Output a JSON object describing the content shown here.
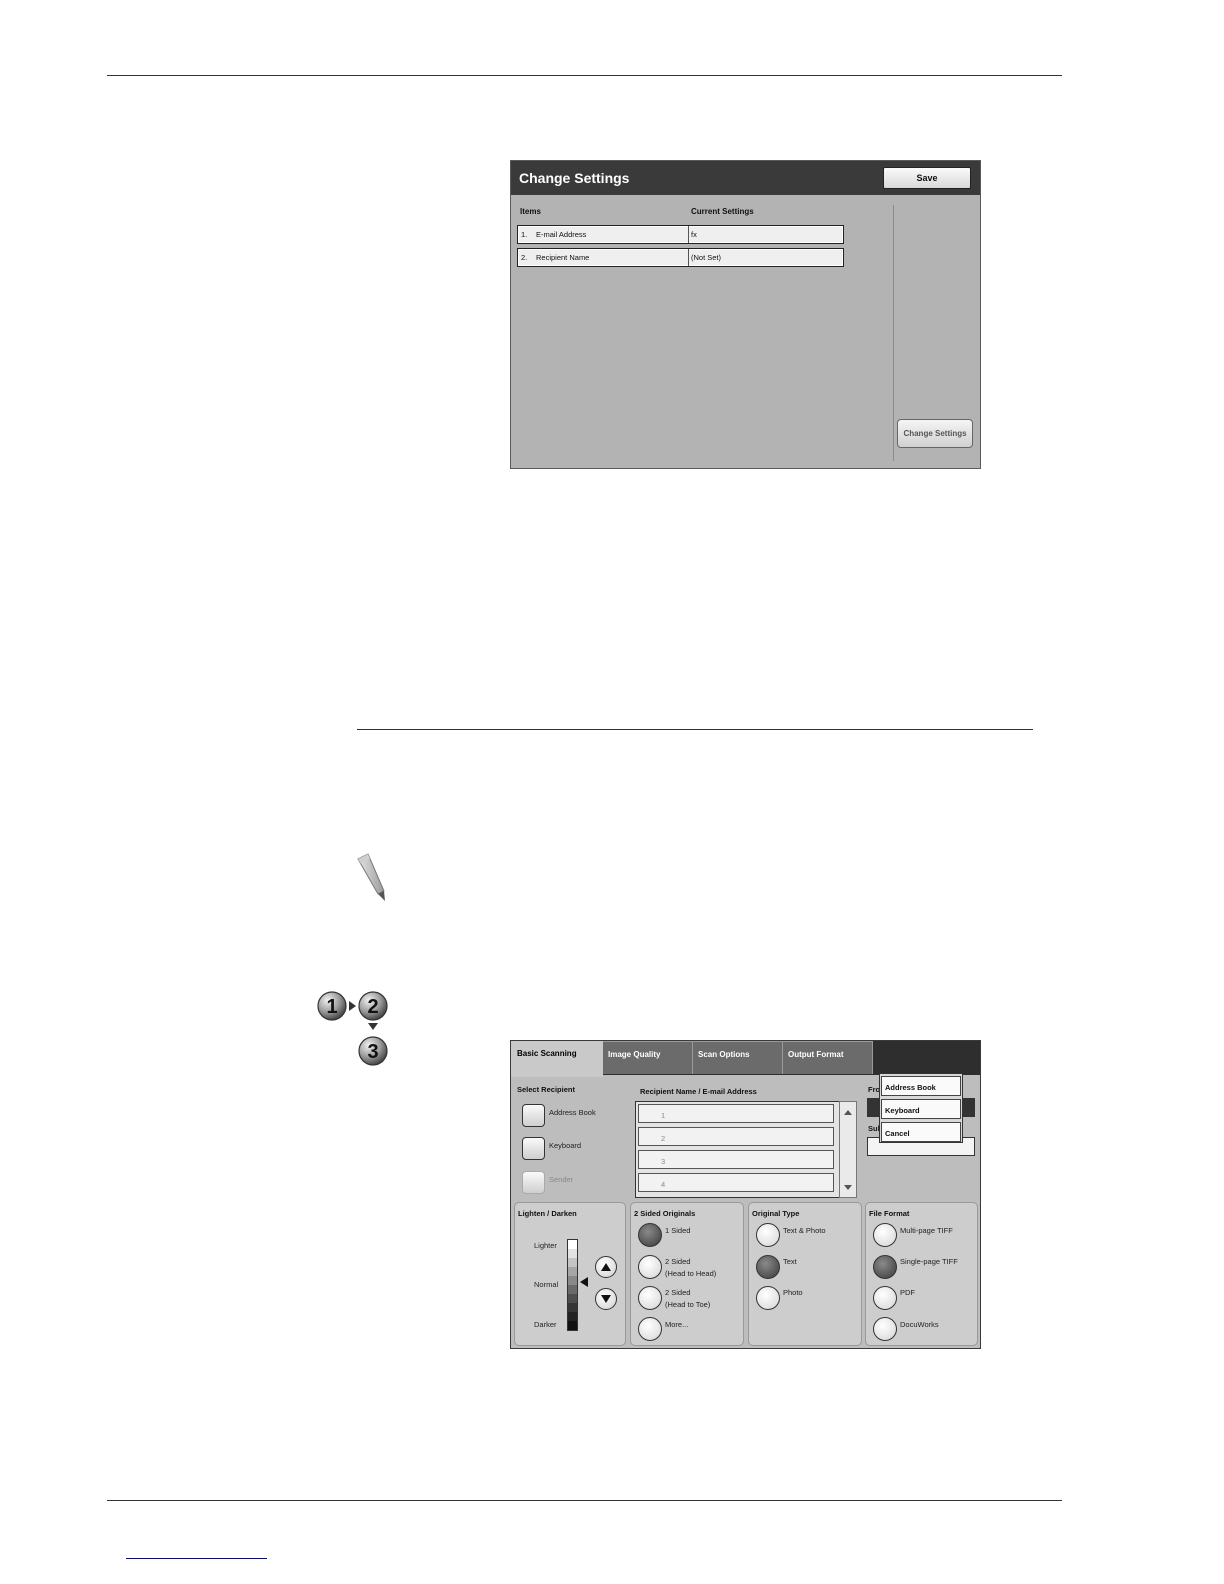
{
  "screen1": {
    "title": "Change Settings",
    "save_label": "Save",
    "col_items": "Items",
    "col_current": "Current Settings",
    "rows": [
      {
        "num": "1.",
        "item": "E-mail Address",
        "value": "fx"
      },
      {
        "num": "2.",
        "item": "Recipient Name",
        "value": "(Not Set)"
      }
    ],
    "change_button": "Change Settings"
  },
  "screen2": {
    "tabs": [
      "Basic Scanning",
      "Image Quality",
      "Scan Options",
      "Output Format"
    ],
    "select_recipient": "Select Recipient",
    "address_book": "Address Book",
    "keyboard": "Keyboard",
    "sender": "Sender",
    "recipient_header": "Recipient Name / E-mail Address",
    "recipient_rows": [
      "1",
      "2",
      "3",
      "4"
    ],
    "from_label": "Fro",
    "subject_label": "Sub",
    "popup": [
      "Address Book",
      "Keyboard",
      "Cancel"
    ],
    "lighten_darken": {
      "title": "Lighten / Darken",
      "lighter": "Lighter",
      "normal": "Normal",
      "darker": "Darker"
    },
    "two_sided": {
      "title": "2 Sided Originals",
      "options": [
        "1 Sided",
        "2 Sided",
        "(Head to Head)",
        "2 Sided",
        "(Head to Toe)",
        "More..."
      ]
    },
    "original_type": {
      "title": "Original Type",
      "options": [
        "Text & Photo",
        "Text",
        "Photo"
      ]
    },
    "file_format": {
      "title": "File Format",
      "options": [
        "Multi-page TIFF",
        "Single-page TIFF",
        "PDF",
        "DocuWorks"
      ]
    }
  },
  "step_icon": {
    "digits": [
      "1",
      "2",
      "3"
    ]
  }
}
